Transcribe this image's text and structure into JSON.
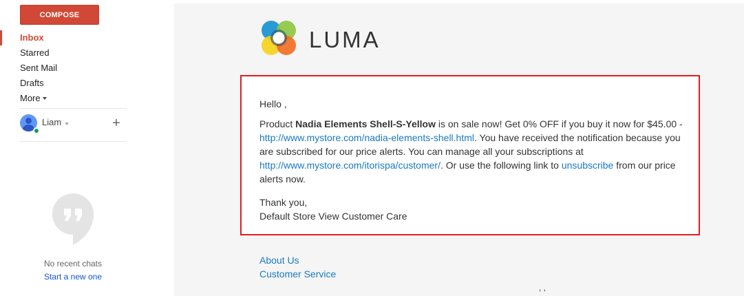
{
  "sidebar": {
    "compose_label": "COMPOSE",
    "items": [
      {
        "label": "Inbox",
        "active": true
      },
      {
        "label": "Starred"
      },
      {
        "label": "Sent Mail"
      },
      {
        "label": "Drafts"
      },
      {
        "label": "More"
      }
    ],
    "user": {
      "name": "Liam",
      "add_label": "+"
    },
    "chat": {
      "empty_text": "No recent chats",
      "start_link": "Start a new one"
    }
  },
  "email": {
    "brand": "LUMA",
    "greeting": "Hello ,",
    "body": {
      "prefix": "Product ",
      "product_name": "Nadia Elements Shell-S-Yellow",
      "sale_text": " is on sale now! Get 0% OFF if you buy it now for $45.00 - ",
      "product_url": "http://www.mystore.com/nadia-elements-shell.html",
      "notice_text": ". You have received the notification because you are subscribed for our price alerts. You can manage all your subscriptions at ",
      "manage_url": "http://www.mystore.com/itorispa/customer/",
      "unsub_prefix": ". Or use the following link to ",
      "unsubscribe_label": "unsubscribe",
      "unsub_suffix": " from our price alerts now."
    },
    "signoff": "Thank you,",
    "signature": "Default Store View Customer Care",
    "footer_links": [
      "About Us",
      "Customer Service"
    ],
    "footer_extra": ", ,"
  },
  "colors": {
    "compose": "#d14836",
    "highlight_border": "#e11b22",
    "link": "#1979c3",
    "chat_link": "#1155cc"
  },
  "icons": {
    "logo": "luma-logo-icon",
    "avatar": "avatar-icon",
    "hangouts": "hangouts-quote-icon"
  }
}
